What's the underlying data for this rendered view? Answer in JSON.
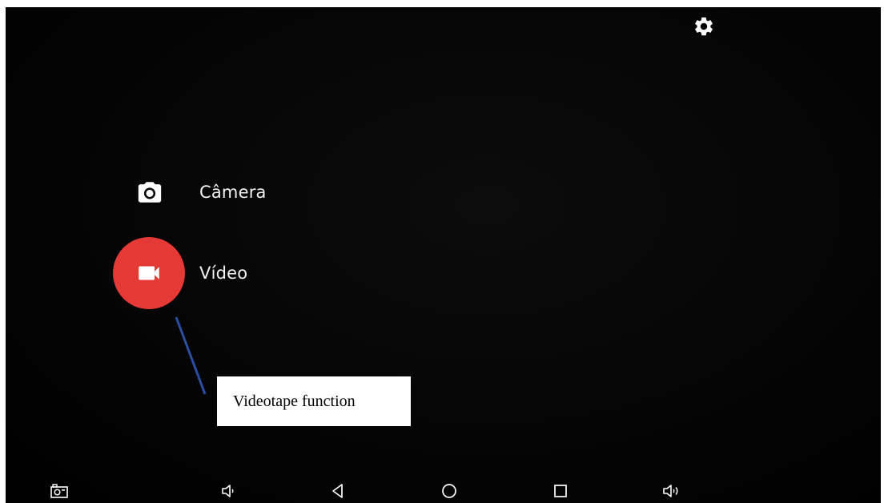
{
  "header": {
    "settings_icon": "gear-icon"
  },
  "modes": {
    "camera": {
      "label": "Câmera",
      "icon": "camera-icon"
    },
    "video": {
      "label": "Vídeo",
      "icon": "videocam-icon",
      "accent": "#e53935"
    }
  },
  "annotation": {
    "text": "Videotape function",
    "line_color": "#2b4ea0"
  },
  "navbar": {
    "items": [
      {
        "icon": "screenshot-icon"
      },
      {
        "icon": "volume-down-icon"
      },
      {
        "icon": "back-icon"
      },
      {
        "icon": "home-icon"
      },
      {
        "icon": "recents-icon"
      },
      {
        "icon": "volume-up-icon"
      }
    ]
  }
}
